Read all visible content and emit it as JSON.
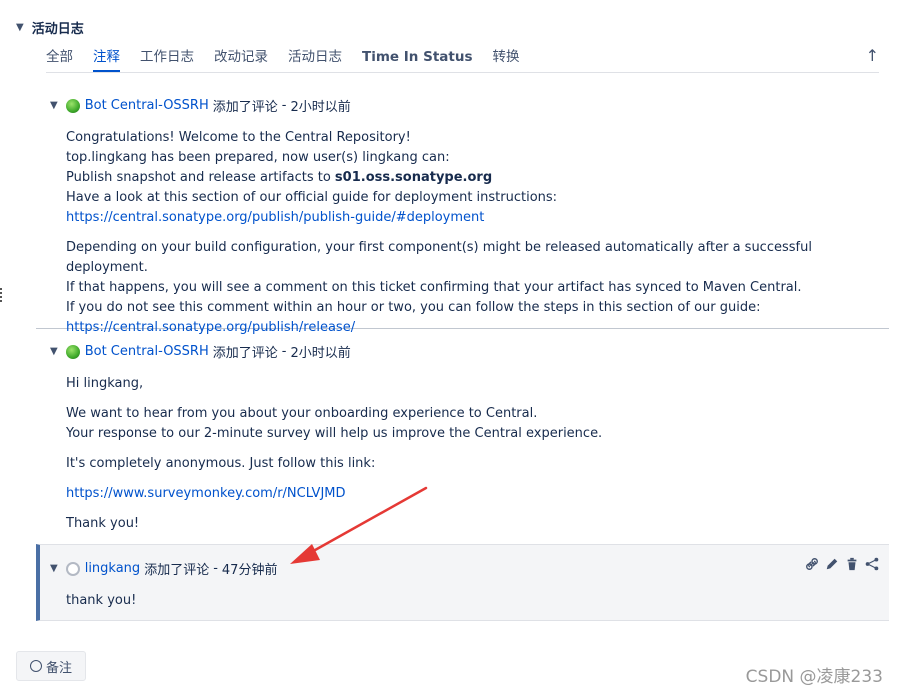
{
  "section": {
    "title": "活动日志",
    "collapse_icon": "chevron-down-icon"
  },
  "tabs": [
    {
      "label": "全部"
    },
    {
      "label": "注释"
    },
    {
      "label": "工作日志"
    },
    {
      "label": "改动记录"
    },
    {
      "label": "活动日志"
    },
    {
      "label": "Time In Status"
    },
    {
      "label": "转换"
    }
  ],
  "sort_icon": "↑",
  "comments": [
    {
      "author": "Bot Central-OSSRH",
      "action": "添加了评论",
      "time": "2小时以前",
      "body": {
        "p1_line1": "Congratulations! Welcome to the Central Repository!",
        "p1_line2": "top.lingkang has been prepared, now user(s) lingkang can:",
        "p1_line3_prefix": "Publish snapshot and release artifacts to ",
        "p1_line3_bold": "s01.oss.sonatype.org",
        "p1_line4": "Have a look at this section of our official guide for deployment instructions:",
        "p1_link": "https://central.sonatype.org/publish/publish-guide/#deployment",
        "p2_line1": "Depending on your build configuration, your first component(s) might be released automatically after a successful deployment.",
        "p2_line2": "If that happens, you will see a comment on this ticket confirming that your artifact has synced to Maven Central.",
        "p2_line3": "If you do not see this comment within an hour or two, you can follow the steps in this section of our guide:",
        "p2_link": "https://central.sonatype.org/publish/release/"
      }
    },
    {
      "author": "Bot Central-OSSRH",
      "action": "添加了评论",
      "time": "2小时以前",
      "body": {
        "greeting": "Hi lingkang,",
        "p1_line1": "We want to hear from you about your onboarding experience to Central.",
        "p1_line2": "Your response to our 2-minute survey will help us improve the Central experience.",
        "p2": "It's completely anonymous. Just follow this link:",
        "link": "https://www.surveymonkey.com/r/NCLVJMD",
        "closing": "Thank you!"
      }
    },
    {
      "author": "lingkang",
      "action": "添加了评论",
      "time": "47分钟前",
      "body": {
        "text": "thank you!"
      },
      "tools": [
        "link-icon",
        "edit-icon",
        "delete-icon",
        "share-icon"
      ]
    }
  ],
  "time_separator": "-",
  "comment_button": {
    "label": "备注",
    "icon": "comment-bubble-icon"
  },
  "watermark": "CSDN @凌康233",
  "colors": {
    "link": "#0052cc",
    "highlight_border": "#4a6fa5",
    "arrow": "#e53935"
  }
}
